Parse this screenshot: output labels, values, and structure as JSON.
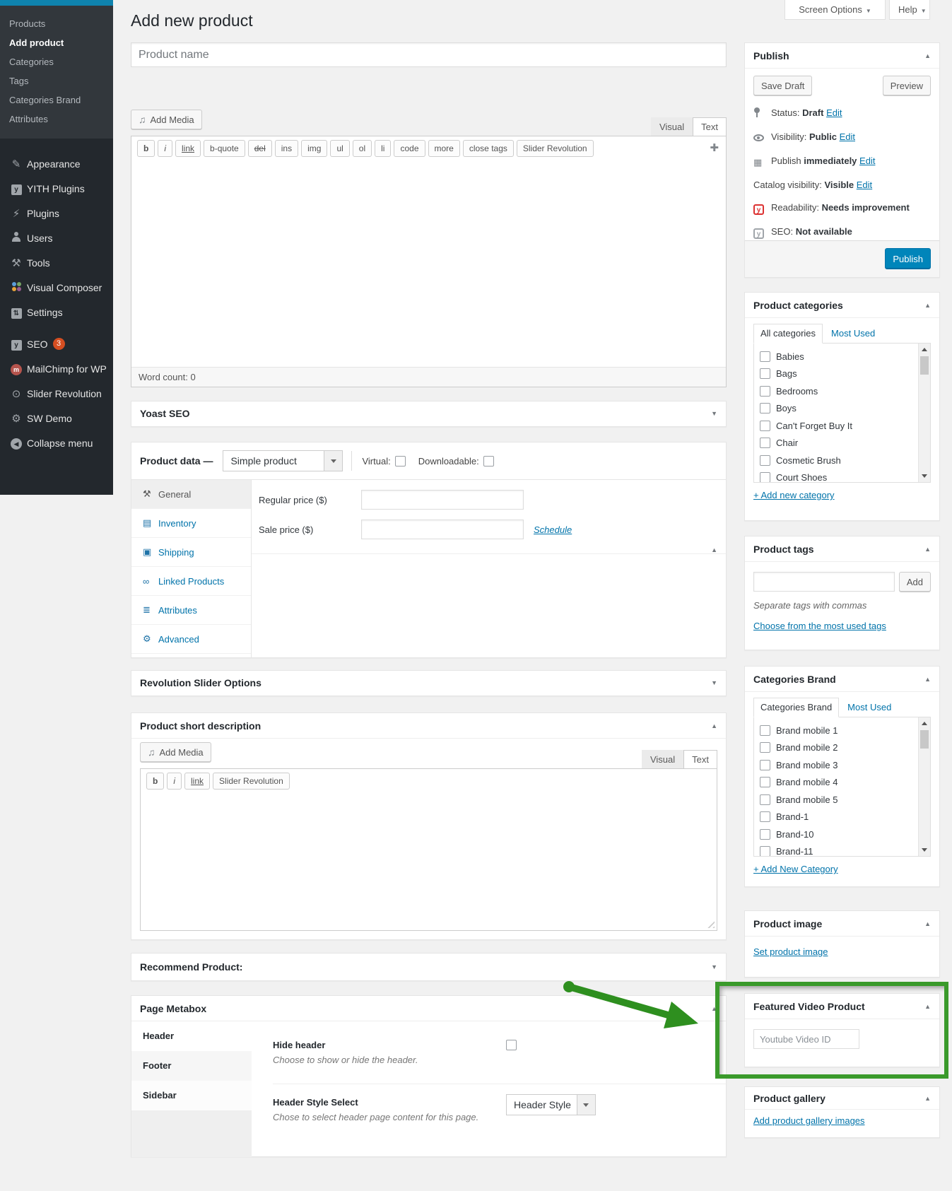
{
  "colors": {
    "accent_blue": "#0073aa",
    "menu_bg": "#23282d",
    "submenu_bg": "#32373c",
    "highlight_green": "#3a9a2b",
    "publish_button": "#0085ba",
    "seo_badge_red": "#d54e21"
  },
  "topbar": {
    "screen_options": "Screen Options",
    "help": "Help"
  },
  "admin_menu": {
    "submenu": [
      "Products",
      "Add product",
      "Categories",
      "Tags",
      "Categories Brand",
      "Attributes"
    ],
    "items": [
      "Appearance",
      "YITH Plugins",
      "Plugins",
      "Users",
      "Tools",
      "Visual Composer",
      "Settings",
      "SEO",
      "MailChimp for WP",
      "Slider Revolution",
      "SW Demo",
      "Collapse menu"
    ],
    "icons": [
      "appearance-icon",
      "yith-icon",
      "plugins-icon",
      "users-icon",
      "tools-icon",
      "visual-composer-icon",
      "settings-icon",
      "seo-icon",
      "mailchimp-icon",
      "slider-revolution-icon",
      "gear-icon",
      "collapse-icon"
    ],
    "seo_badge": "3"
  },
  "page": {
    "title": "Add new product"
  },
  "product_name": {
    "placeholder": "Product name"
  },
  "main_editor": {
    "add_media": "Add Media",
    "visual_tab": "Visual",
    "text_tab": "Text",
    "quicktags": [
      "b",
      "i",
      "link",
      "b-quote",
      "del",
      "ins",
      "img",
      "ul",
      "ol",
      "li",
      "code",
      "more",
      "close tags",
      "Slider Revolution"
    ],
    "word_count_label": "Word count:",
    "word_count_value": "0"
  },
  "yoast_panel": {
    "title": "Yoast SEO"
  },
  "product_data": {
    "label": "Product data —",
    "product_type": "Simple product",
    "virtual_label": "Virtual:",
    "downloadable_label": "Downloadable:",
    "tabs": [
      "General",
      "Inventory",
      "Shipping",
      "Linked Products",
      "Attributes",
      "Advanced"
    ],
    "tab_icons": [
      "wrench-icon",
      "inventory-icon",
      "truck-icon",
      "link-icon",
      "list-icon",
      "gear-icon"
    ],
    "regular_price_label": "Regular price ($)",
    "sale_price_label": "Sale price ($)",
    "schedule_link": "Schedule"
  },
  "revslider_panel": {
    "title": "Revolution Slider Options"
  },
  "short_desc_panel": {
    "title": "Product short description",
    "add_media": "Add Media",
    "visual_tab": "Visual",
    "text_tab": "Text",
    "quicktags": [
      "b",
      "i",
      "link",
      "Slider Revolution"
    ]
  },
  "recommend_panel": {
    "title": "Recommend Product:"
  },
  "page_metabox": {
    "title": "Page Metabox",
    "tabs": [
      "Header",
      "Footer",
      "Sidebar"
    ],
    "hide_header_label": "Hide header",
    "hide_header_desc": "Choose to show or hide the header.",
    "header_style_label": "Header Style Select",
    "header_style_desc": "Chose to select header page content for this page.",
    "header_style_value": "Header Style"
  },
  "publish": {
    "title": "Publish",
    "save_draft": "Save Draft",
    "preview": "Preview",
    "rows": [
      {
        "label": "Status:",
        "value": "Draft",
        "edit": "Edit"
      },
      {
        "label": "Visibility:",
        "value": "Public",
        "edit": "Edit"
      },
      {
        "label": "Publish",
        "value": "immediately",
        "edit": "Edit"
      },
      {
        "label": "Catalog visibility:",
        "value": "Visible",
        "edit": "Edit"
      },
      {
        "label": "Readability:",
        "value": "Needs improvement",
        "edit": ""
      },
      {
        "label": "SEO:",
        "value": "Not available",
        "edit": ""
      }
    ],
    "publish_button": "Publish"
  },
  "categories_panel": {
    "title": "Product categories",
    "tab_all": "All categories",
    "tab_most_used": "Most Used",
    "items": [
      "Babies",
      "Bags",
      "Bedrooms",
      "Boys",
      "Can't Forget Buy It",
      "Chair",
      "Cosmetic Brush",
      "Court Shoes"
    ],
    "add_link": "+ Add new category"
  },
  "tags_panel": {
    "title": "Product tags",
    "add_button": "Add",
    "hint": "Separate tags with commas",
    "choose_link": "Choose from the most used tags"
  },
  "brand_panel": {
    "title": "Categories Brand",
    "tab_main": "Categories Brand",
    "tab_most_used": "Most Used",
    "items": [
      "Brand mobile 1",
      "Brand mobile 2",
      "Brand mobile 3",
      "Brand mobile 4",
      "Brand mobile 5",
      "Brand-1",
      "Brand-10",
      "Brand-11"
    ],
    "add_link": "+ Add New Category"
  },
  "image_panel": {
    "title": "Product image",
    "set_link": "Set product image"
  },
  "video_panel": {
    "title": "Featured Video Product",
    "placeholder": "Youtube Video ID"
  },
  "gallery_panel": {
    "title": "Product gallery",
    "add_link": "Add product gallery images"
  }
}
